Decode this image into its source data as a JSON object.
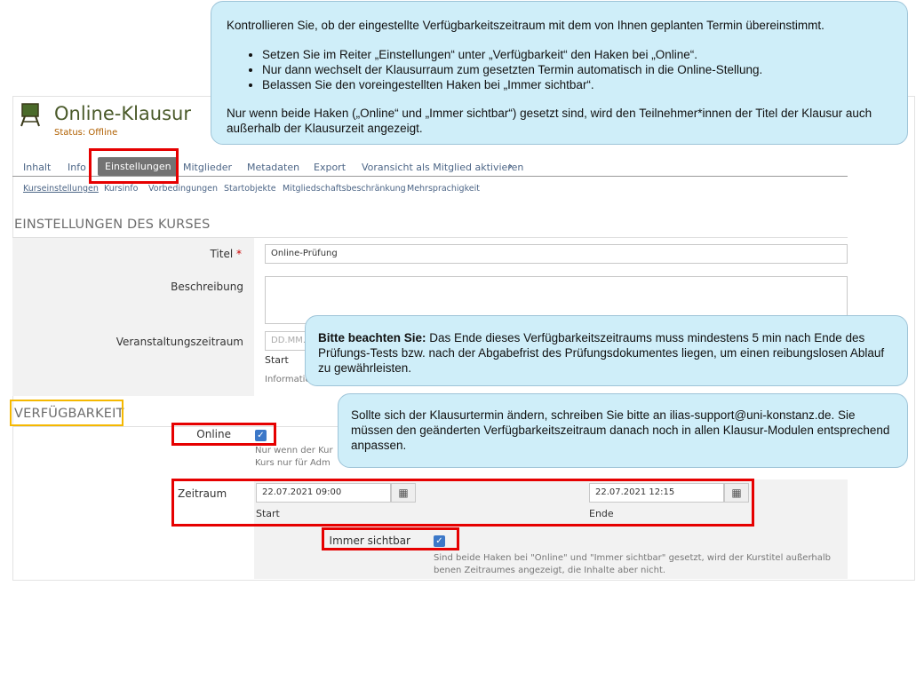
{
  "header": {
    "title": "Online-Klausur",
    "status": "Status: Offline"
  },
  "tabs": [
    "Inhalt",
    "Info",
    "Einstellungen",
    "Mitglieder",
    "Metadaten",
    "Export",
    "Voransicht als Mitglied aktivieren"
  ],
  "subtabs": [
    "Kurseinstellungen",
    "Kursinfo",
    "Vorbedingungen",
    "Startobjekte",
    "Mitgliedschaftsbeschränkung",
    "Mehrsprachigkeit"
  ],
  "settings": {
    "heading": "EINSTELLUNGEN DES KURSES",
    "title_label": "Titel",
    "required_mark": "*",
    "title_value": "Online-Prüfung",
    "description_label": "Beschreibung",
    "period_label": "Veranstaltungszeitraum",
    "period_placeholder": "DD.MM.Y",
    "period_start": "Start",
    "period_info": "Informatio"
  },
  "availability": {
    "heading": "VERFÜGBARKEIT",
    "online_label": "Online",
    "online_info_1": "Nur wenn der Kur",
    "online_info_2": "Kurs nur für Adm",
    "period_label": "Zeitraum",
    "start_value": "22.07.2021 09:00",
    "start_label": "Start",
    "end_value": "22.07.2021 12:15",
    "end_label": "Ende",
    "always_visible_label": "Immer sichtbar",
    "always_info_1": "Sind beide Haken bei \"Online\" und \"Immer sichtbar\" gesetzt, wird der Kurstitel außerhalb",
    "always_info_2": "benen Zeitraumes angezeigt, die Inhalte aber nicht."
  },
  "callouts": {
    "top_intro": "Kontrollieren Sie, ob der eingestellte Verfügbarkeitszeitraum mit dem von Ihnen geplanten Termin übereinstimmt.",
    "top_bullets": [
      "Setzen Sie im Reiter „Einstellungen“ unter „Verfügbarkeit“ den Haken bei „Online“.",
      "Nur dann wechselt der Klausurraum zum gesetzten Termin automatisch in die   Online-Stellung.",
      "Belassen Sie den voreingestellten Haken bei „Immer sichtbar“."
    ],
    "top_outro": "Nur wenn beide Haken („Online“ und „Immer sichtbar“) gesetzt sind, wird den Teilnehmer*innen der Titel der Klausur auch außerhalb der Klausurzeit angezeigt.",
    "middle_bold": "Bitte beachten Sie:",
    "middle_text": " Das Ende dieses Verfügbarkeitszeitraums muss mindestens 5 min nach Ende des Prüfungs-Tests bzw. nach der Abgabefrist des Prüfungsdokumentes liegen, um einen reibungslosen Ablauf zu gewährleisten.",
    "bottom_text": "Sollte sich der Klausurtermin ändern, schreiben Sie bitte an ilias-support@uni-konstanz.de. Sie müssen den geänderten Verfügbarkeitszeitraum danach noch in allen Klausur-Modulen entsprechend anpassen."
  },
  "colors": {
    "highlight_red": "#e60000",
    "highlight_yellow": "#f5b800",
    "callout_bg": "#cfeef9",
    "checkbox_blue": "#3c78c8"
  }
}
